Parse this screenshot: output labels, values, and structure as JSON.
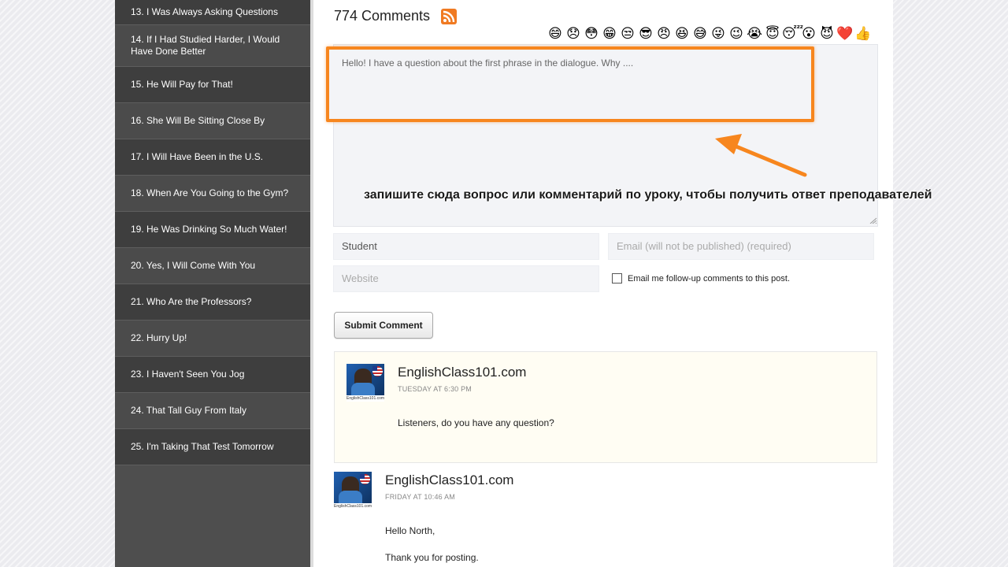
{
  "sidebar": {
    "items": [
      {
        "label": "13. I Was Always Asking Questions"
      },
      {
        "label": "14. If I Had Studied Harder, I Would Have Done Better"
      },
      {
        "label": "15. He Will Pay for That!"
      },
      {
        "label": "16. She Will Be Sitting Close By"
      },
      {
        "label": "17. I Will Have Been in the U.S."
      },
      {
        "label": "18. When Are You Going to the Gym?"
      },
      {
        "label": "19. He Was Drinking So Much Water!"
      },
      {
        "label": "20. Yes, I Will Come With You"
      },
      {
        "label": "21. Who Are the Professors?"
      },
      {
        "label": "22. Hurry Up!"
      },
      {
        "label": "23. I Haven't Seen You Jog"
      },
      {
        "label": "24. That Tall Guy From Italy"
      },
      {
        "label": "25. I'm Taking That Test Tomorrow"
      }
    ]
  },
  "comments": {
    "count_label": "774 Comments",
    "emojis": [
      "😄",
      "😞",
      "😳",
      "😁",
      "😒",
      "😎",
      "😠",
      "😆",
      "😅",
      "😜",
      "😉",
      "😭",
      "😇",
      "😴",
      "😮",
      "😈",
      "❤️",
      "👍"
    ]
  },
  "form": {
    "textarea_value": "Hello! I have a question about the first phrase in the dialogue. Why ....",
    "name_value": "Student",
    "email_placeholder": "Email (will not be published) (required)",
    "website_placeholder": "Website",
    "followup_label": "Email me follow-up comments to this post.",
    "submit_label": "Submit Comment"
  },
  "annotation": {
    "hint": "запишите сюда вопрос или комментарий по уроку, чтобы получить ответ преподавателей",
    "accent_color": "#f7861e"
  },
  "comment_list": [
    {
      "author": "EnglishClass101.com",
      "time": "TUESDAY AT 6:30 PM",
      "avatar_caption": "EnglishClass101.com",
      "lines": [
        "Listeners, do you have any question?"
      ]
    },
    {
      "author": "EnglishClass101.com",
      "time": "FRIDAY AT 10:46 AM",
      "avatar_caption": "EnglishClass101.com",
      "lines": [
        "Hello North,",
        "Thank you for posting."
      ]
    }
  ]
}
